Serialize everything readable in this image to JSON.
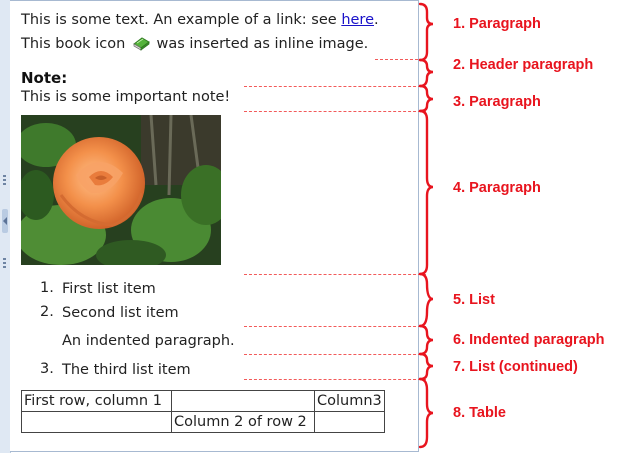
{
  "editor": {
    "para1": {
      "text_before_link": "This is some text. An example of a link: see ",
      "link_text": "here",
      "text_after_link": ".",
      "line2_before_icon": "This book icon",
      "book_icon": "book-icon",
      "line2_after_icon": "was inserted as inline image."
    },
    "note_heading": "Note:",
    "note_text": "This is some important note!",
    "image": "rose-photo",
    "list": [
      {
        "num": "1.",
        "label": "First list item"
      },
      {
        "num": "2.",
        "label": "Second list item"
      }
    ],
    "indented_paragraph": "An indented paragraph.",
    "list_continued": {
      "num": "3.",
      "label": "The third list item"
    },
    "table": {
      "rows": [
        [
          "First row, column 1",
          "",
          "Column3"
        ],
        [
          "",
          "Column 2 of row 2",
          ""
        ]
      ]
    }
  },
  "annotations": [
    "1. Paragraph",
    "2. Header paragraph",
    "3. Paragraph",
    "4. Paragraph",
    "5. List",
    "6. Indented paragraph",
    "7. List (continued)",
    "8. Table"
  ],
  "colors": {
    "annotation": "#e8141e",
    "dashes": "#f25a5a",
    "link": "#1a12c9"
  }
}
